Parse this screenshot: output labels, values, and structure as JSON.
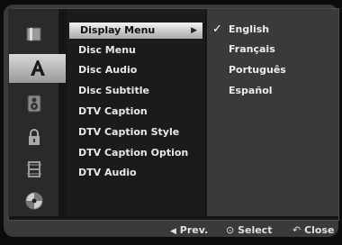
{
  "sidebar": {
    "icons": [
      {
        "name": "disc-icon"
      },
      {
        "name": "language-icon"
      },
      {
        "name": "speaker-icon"
      },
      {
        "name": "lock-icon"
      },
      {
        "name": "film-icon"
      },
      {
        "name": "dvd-icon"
      }
    ],
    "active_index": 1
  },
  "menu": {
    "items": [
      "Display Menu",
      "Disc Menu",
      "Disc Audio",
      "Disc Subtitle",
      "DTV Caption",
      "DTV Caption Style",
      "DTV Caption Option",
      "DTV Audio"
    ],
    "selected_index": 0
  },
  "options": {
    "items": [
      "English",
      "Français",
      "Português",
      "Español"
    ],
    "checked_index": 0
  },
  "footer": {
    "prev_label": "Prev.",
    "select_label": "Select",
    "close_label": "Close"
  }
}
